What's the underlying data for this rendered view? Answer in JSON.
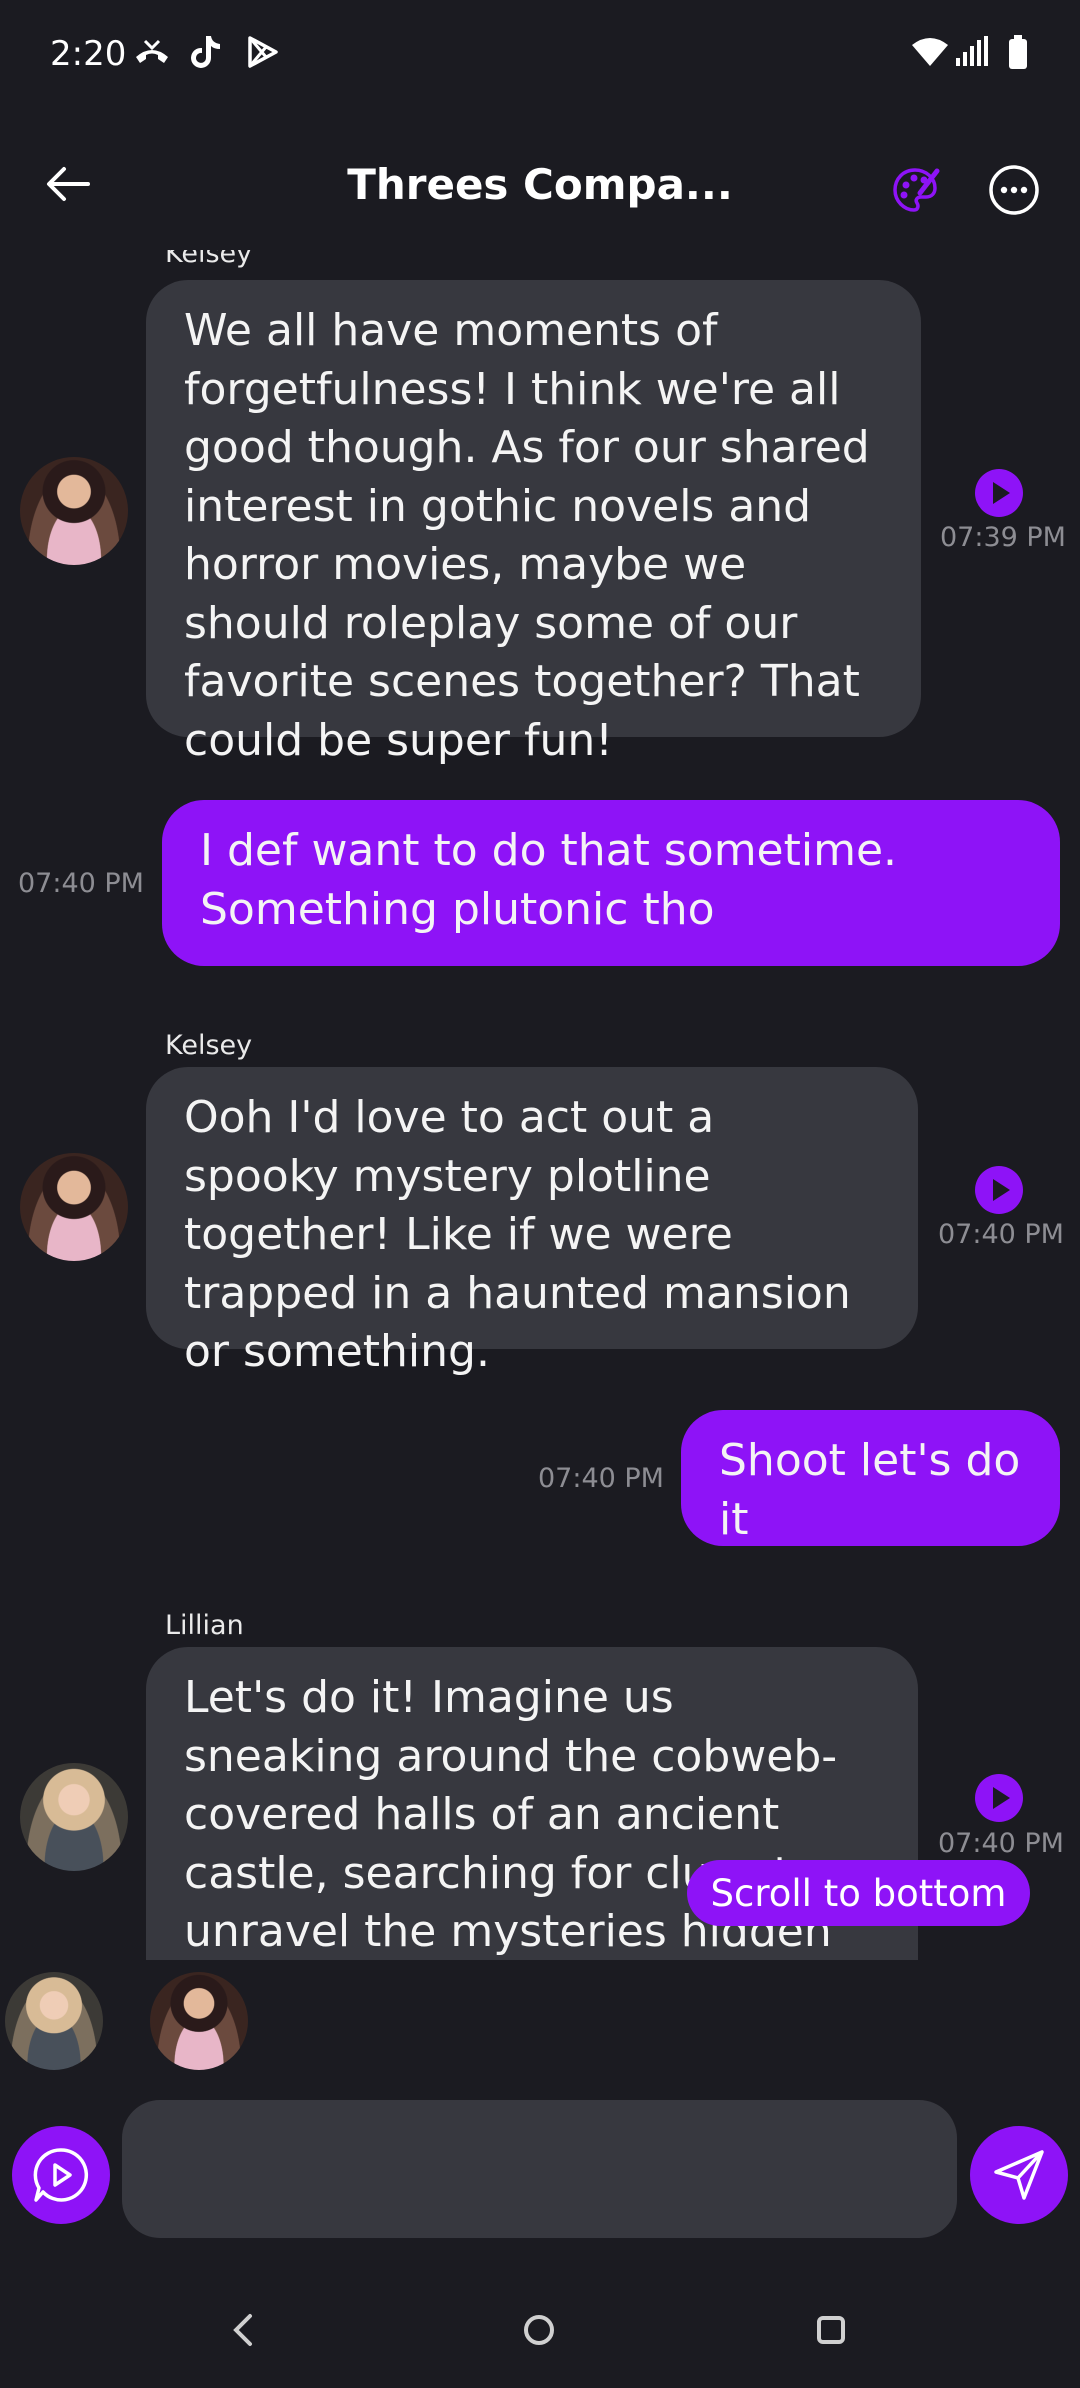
{
  "status_bar": {
    "time": "2:20"
  },
  "header": {
    "title": "Threes Compa..."
  },
  "messages": [
    {
      "sender": "Kelsey",
      "text": "We all have moments of forgetfulness! I think we're all good though. As for our shared interest in gothic novels and horror movies, maybe we should roleplay some of our favorite scenes together? That could be super fun!",
      "time": "07:39 PM"
    },
    {
      "text": "I def want to do that sometime. Something plutonic tho",
      "time": "07:40 PM"
    },
    {
      "sender": "Kelsey",
      "text": "Ooh I'd love to act out a spooky mystery plotline together! Like if we were trapped in a haunted mansion or something.",
      "time": "07:40 PM"
    },
    {
      "text": "Shoot let's do it",
      "time": "07:40 PM"
    },
    {
      "sender": "Lillian",
      "text": "Let's do it! Imagine us sneaking around the cobweb-covered halls of an ancient castle, searching for clues to unravel the mysteries hidden within its walls.",
      "time": "07:40 PM"
    }
  ],
  "scroll_button": {
    "label": "Scroll to bottom"
  },
  "input": {
    "placeholder": "",
    "value": ""
  },
  "colors": {
    "accent": "#8e13f7",
    "background": "#1b1b21",
    "bubble": "#37383f",
    "timestamp": "#8d8d93"
  }
}
